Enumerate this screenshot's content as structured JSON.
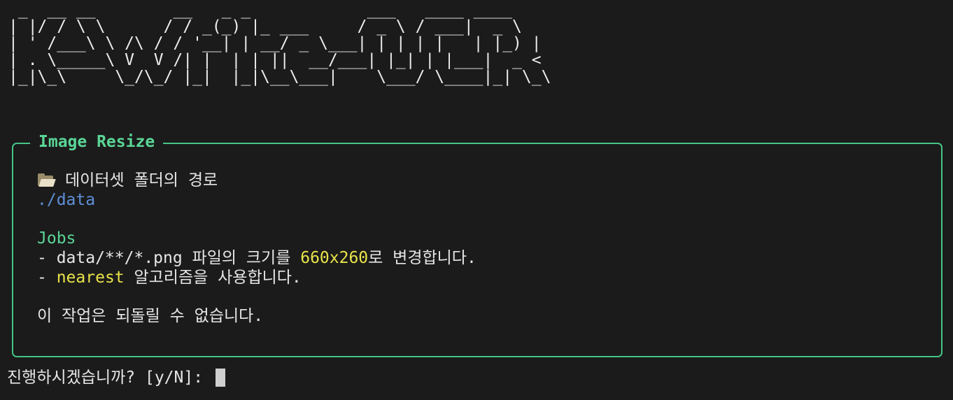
{
  "banner": {
    "art": " _  __ __        __   _ _            ___   ____ ____  \n| |/ / \\ \\      / / _(_) |_ ___     / _ \\ / ___|  _ \\ \n| ' /___\\ \\ /\\ / / '__| | __/ _ \\___| | | | |   | |_) |\n| . \\_____\\ V  V /| |  | | ||  __/___| |_| | |___|  _ < \n|_|\\_\\     \\_/\\_/ |_|  |_|\\__\\___|    \\___/ \\____|_| \\_\\"
  },
  "panel": {
    "title": "Image Resize",
    "dataset_label": "데이터셋 폴더의 경로",
    "dataset_path": "./data",
    "jobs_heading": "Jobs",
    "job1": {
      "prefix": "- data/**/*.png 파일의 크기를 ",
      "size": "660x260",
      "suffix": "로 변경합니다."
    },
    "job2": {
      "prefix": "- ",
      "algorithm": "nearest",
      "suffix": " 알고리즘을 사용합니다."
    },
    "warning": "이 작업은 되돌릴 수 없습니다."
  },
  "prompt": {
    "text": "진행하시겠습니까? [y/N]: "
  },
  "icons": {
    "dataset": "open-folder-icon"
  },
  "colors": {
    "background": "#1b1b1b",
    "accent": "#45c486",
    "path": "#5f8fd8",
    "highlight": "#e8e34a"
  }
}
